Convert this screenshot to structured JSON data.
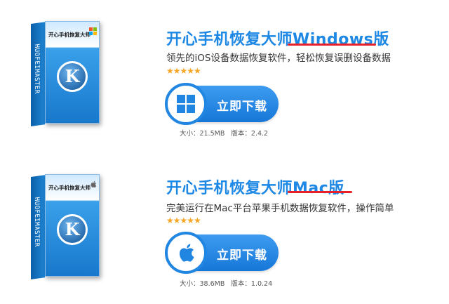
{
  "products": [
    {
      "title": "开心手机恢复大师Windows版",
      "description": "领先的iOS设备数据恢复软件，轻松恢复误删设备数据",
      "rating": "★★★★★",
      "download_label": "立即下载",
      "size": "大小：21.5MB",
      "version": "版本：2.4.2",
      "os_icon": "windows-icon",
      "box_title": "开心手机恢复大师",
      "box_side": "HUOFEIMASTER"
    },
    {
      "title": "开心手机恢复大师Mac版",
      "description": "完美运行在Mac平台苹果手机数据恢复软件，操作简单",
      "rating": "★★★★★",
      "download_label": "立即下载",
      "size": "大小：38.6MB",
      "version": "版本：1.0.24",
      "os_icon": "apple-icon",
      "box_title": "开心手机恢复大师",
      "box_side": "HUOFEIMASTER"
    }
  ],
  "colors": {
    "accent": "#1e88e5",
    "underline": "#e8202a",
    "stars": "#f5a623",
    "button": "#1677d8"
  }
}
